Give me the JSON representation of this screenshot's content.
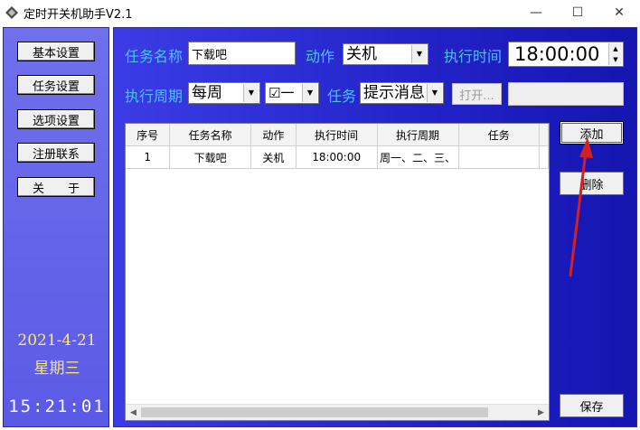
{
  "window": {
    "title": "定时开关机助手V2.1",
    "min_glyph": "—",
    "max_glyph": "☐",
    "close_glyph": "✕"
  },
  "sidebar": {
    "buttons": [
      "基本设置",
      "任务设置",
      "选项设置",
      "注册联系",
      "关　　于"
    ],
    "date": "2021-4-21",
    "weekday": "星期三",
    "time": "15:21:01"
  },
  "form": {
    "task_name_label": "任务名称",
    "task_name_value": "下载吧",
    "action_label": "动作",
    "action_value": "关机",
    "exec_time_label": "执行时间",
    "exec_time_value": "18:00:00",
    "period_label": "执行周期",
    "period_value": "每周",
    "day_value": "☑一",
    "task_label": "任务",
    "task_value": "提示消息",
    "open_button": "打开...",
    "path_value": ""
  },
  "buttons": {
    "add": "添加",
    "delete": "删除",
    "save": "保存"
  },
  "table": {
    "columns": [
      "序号",
      "任务名称",
      "动作",
      "执行时间",
      "执行周期",
      "任务"
    ],
    "rows": [
      [
        "1",
        "下载吧",
        "关机",
        "18:00:00",
        "周一、二、三、",
        ""
      ]
    ]
  },
  "colors": {
    "label": "#4ec0ff",
    "date": "#ffe86a",
    "annotation_arrow": "#d42020"
  }
}
